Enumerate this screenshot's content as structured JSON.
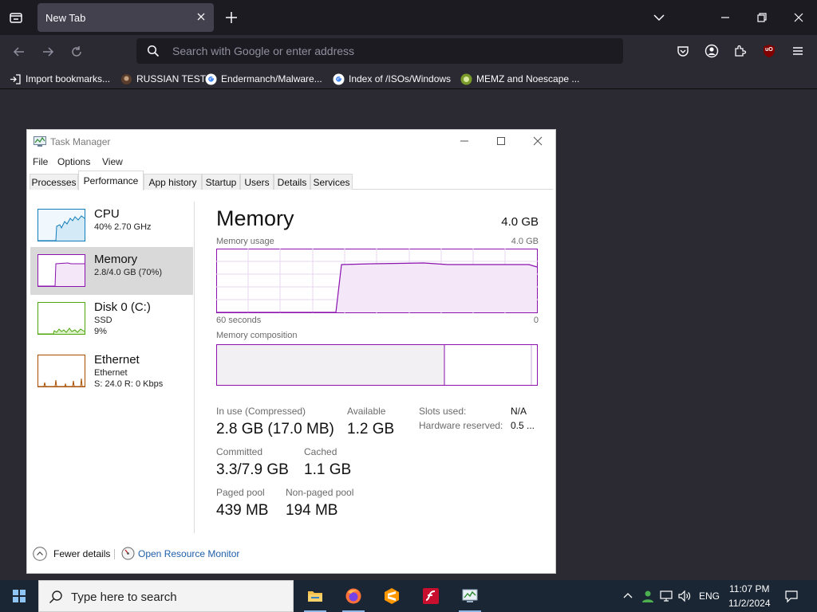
{
  "browser": {
    "tab_title": "New Tab",
    "search_placeholder": "Search with Google or enter address",
    "bookmarks": [
      "Import bookmarks...",
      "RUSSIAN TEST",
      "Endermanch/Malware...",
      "Index of /ISOs/Windows",
      "MEMZ and Noescape ..."
    ],
    "extension_badge": "uO"
  },
  "task_manager": {
    "title": "Task Manager",
    "menu": [
      "File",
      "Options",
      "View"
    ],
    "tabs": [
      "Processes",
      "Performance",
      "App history",
      "Startup",
      "Users",
      "Details",
      "Services"
    ],
    "active_tab": "Performance",
    "sidebar": [
      {
        "name": "CPU",
        "line1": "40%  2.70 GHz",
        "line2": ""
      },
      {
        "name": "Memory",
        "line1": "2.8/4.0 GB (70%)",
        "line2": ""
      },
      {
        "name": "Disk 0 (C:)",
        "line1": "SSD",
        "line2": "9%"
      },
      {
        "name": "Ethernet",
        "line1": "Ethernet",
        "line2": "S: 24.0  R: 0 Kbps"
      }
    ],
    "memory": {
      "heading": "Memory",
      "total": "4.0 GB",
      "usage_label": "Memory usage",
      "usage_max": "4.0 GB",
      "time_span": "60 seconds",
      "time_end": "0",
      "composition_label": "Memory composition",
      "in_use_label": "In use (Compressed)",
      "in_use_value": "2.8 GB (17.0 MB)",
      "available_label": "Available",
      "available_value": "1.2 GB",
      "committed_label": "Committed",
      "committed_value": "3.3/7.9 GB",
      "cached_label": "Cached",
      "cached_value": "1.1 GB",
      "paged_label": "Paged pool",
      "paged_value": "439 MB",
      "nonpaged_label": "Non-paged pool",
      "nonpaged_value": "194 MB",
      "slots_label": "Slots used:",
      "slots_value": "N/A",
      "hw_reserved_label": "Hardware reserved:",
      "hw_reserved_value": "0.5 ..."
    },
    "footer": {
      "fewer_details": "Fewer details",
      "open_resource_monitor": "Open Resource Monitor"
    }
  },
  "taskbar": {
    "search_text": "Type here to search",
    "language": "ENG",
    "time": "11:07 PM",
    "date": "11/2/2024"
  },
  "colors": {
    "memory_accent": "#8b12ae",
    "cpu_accent": "#117dbb",
    "disk_accent": "#4da60c",
    "ethernet_accent": "#a74f01",
    "link": "#1f5fa8"
  }
}
